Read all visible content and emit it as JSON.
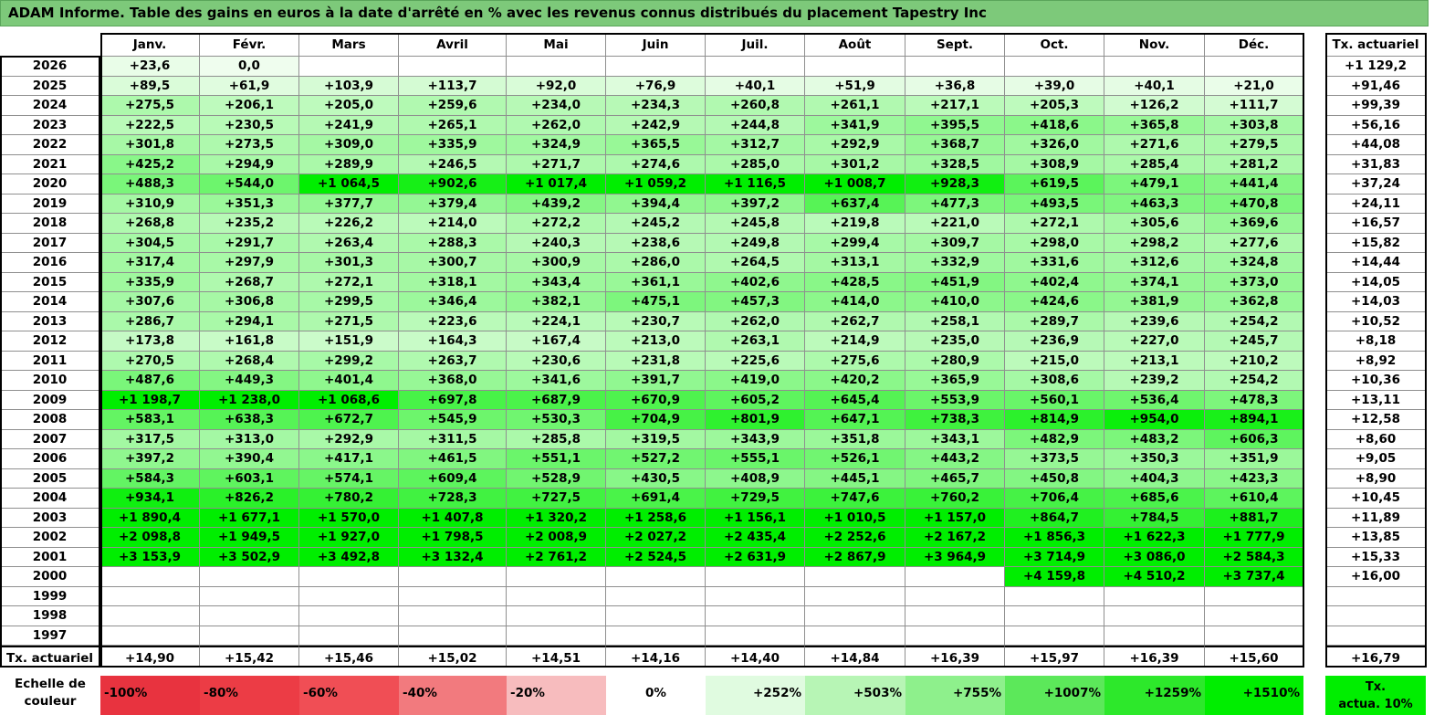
{
  "title": "ADAM Informe. Table des gains en euros à la date d'arrêté en % avec les revenus connus distribués du placement Tapestry Inc",
  "months": [
    "Janv.",
    "Févr.",
    "Mars",
    "Avril",
    "Mai",
    "Juin",
    "Juil.",
    "Août",
    "Sept.",
    "Oct.",
    "Nov.",
    "Déc."
  ],
  "rate_header": "Tx. actuariel",
  "rows": [
    {
      "year": "2026",
      "values": [
        "+23,6",
        "0,0",
        "",
        "",
        "",
        "",
        "",
        "",
        "",
        "",
        "",
        ""
      ],
      "rate": "+1 129,2"
    },
    {
      "year": "2025",
      "values": [
        "+89,5",
        "+61,9",
        "+103,9",
        "+113,7",
        "+92,0",
        "+76,9",
        "+40,1",
        "+51,9",
        "+36,8",
        "+39,0",
        "+40,1",
        "+21,0"
      ],
      "rate": "+91,46"
    },
    {
      "year": "2024",
      "values": [
        "+275,5",
        "+206,1",
        "+205,0",
        "+259,6",
        "+234,0",
        "+234,3",
        "+260,8",
        "+261,1",
        "+217,1",
        "+205,3",
        "+126,2",
        "+111,7"
      ],
      "rate": "+99,39"
    },
    {
      "year": "2023",
      "values": [
        "+222,5",
        "+230,5",
        "+241,9",
        "+265,1",
        "+262,0",
        "+242,9",
        "+244,8",
        "+341,9",
        "+395,5",
        "+418,6",
        "+365,8",
        "+303,8"
      ],
      "rate": "+56,16"
    },
    {
      "year": "2022",
      "values": [
        "+301,8",
        "+273,5",
        "+309,0",
        "+335,9",
        "+324,9",
        "+365,5",
        "+312,7",
        "+292,9",
        "+368,7",
        "+326,0",
        "+271,6",
        "+279,5"
      ],
      "rate": "+44,08"
    },
    {
      "year": "2021",
      "values": [
        "+425,2",
        "+294,9",
        "+289,9",
        "+246,5",
        "+271,7",
        "+274,6",
        "+285,0",
        "+301,2",
        "+328,5",
        "+308,9",
        "+285,4",
        "+281,2"
      ],
      "rate": "+31,83"
    },
    {
      "year": "2020",
      "values": [
        "+488,3",
        "+544,0",
        "+1 064,5",
        "+902,6",
        "+1 017,4",
        "+1 059,2",
        "+1 116,5",
        "+1 008,7",
        "+928,3",
        "+619,5",
        "+479,1",
        "+441,4"
      ],
      "rate": "+37,24"
    },
    {
      "year": "2019",
      "values": [
        "+310,9",
        "+351,3",
        "+377,7",
        "+379,4",
        "+439,2",
        "+394,4",
        "+397,2",
        "+637,4",
        "+477,3",
        "+493,5",
        "+463,3",
        "+470,8"
      ],
      "rate": "+24,11"
    },
    {
      "year": "2018",
      "values": [
        "+268,8",
        "+235,2",
        "+226,2",
        "+214,0",
        "+272,2",
        "+245,2",
        "+245,8",
        "+219,8",
        "+221,0",
        "+272,1",
        "+305,6",
        "+369,6"
      ],
      "rate": "+16,57"
    },
    {
      "year": "2017",
      "values": [
        "+304,5",
        "+291,7",
        "+263,4",
        "+288,3",
        "+240,3",
        "+238,6",
        "+249,8",
        "+299,4",
        "+309,7",
        "+298,0",
        "+298,2",
        "+277,6"
      ],
      "rate": "+15,82"
    },
    {
      "year": "2016",
      "values": [
        "+317,4",
        "+297,9",
        "+301,3",
        "+300,7",
        "+300,9",
        "+286,0",
        "+264,5",
        "+313,1",
        "+332,9",
        "+331,6",
        "+312,6",
        "+324,8"
      ],
      "rate": "+14,44"
    },
    {
      "year": "2015",
      "values": [
        "+335,9",
        "+268,7",
        "+272,1",
        "+318,1",
        "+343,4",
        "+361,1",
        "+402,6",
        "+428,5",
        "+451,9",
        "+402,4",
        "+374,1",
        "+373,0"
      ],
      "rate": "+14,05"
    },
    {
      "year": "2014",
      "values": [
        "+307,6",
        "+306,8",
        "+299,5",
        "+346,4",
        "+382,1",
        "+475,1",
        "+457,3",
        "+414,0",
        "+410,0",
        "+424,6",
        "+381,9",
        "+362,8"
      ],
      "rate": "+14,03"
    },
    {
      "year": "2013",
      "values": [
        "+286,7",
        "+294,1",
        "+271,5",
        "+223,6",
        "+224,1",
        "+230,7",
        "+262,0",
        "+262,7",
        "+258,1",
        "+289,7",
        "+239,6",
        "+254,2"
      ],
      "rate": "+10,52"
    },
    {
      "year": "2012",
      "values": [
        "+173,8",
        "+161,8",
        "+151,9",
        "+164,3",
        "+167,4",
        "+213,0",
        "+263,1",
        "+214,9",
        "+235,0",
        "+236,9",
        "+227,0",
        "+245,7"
      ],
      "rate": "+8,18"
    },
    {
      "year": "2011",
      "values": [
        "+270,5",
        "+268,4",
        "+299,2",
        "+263,7",
        "+230,6",
        "+231,8",
        "+225,6",
        "+275,6",
        "+280,9",
        "+215,0",
        "+213,1",
        "+210,2"
      ],
      "rate": "+8,92"
    },
    {
      "year": "2010",
      "values": [
        "+487,6",
        "+449,3",
        "+401,4",
        "+368,0",
        "+341,6",
        "+391,7",
        "+419,0",
        "+420,2",
        "+365,9",
        "+308,6",
        "+239,2",
        "+254,2"
      ],
      "rate": "+10,36"
    },
    {
      "year": "2009",
      "values": [
        "+1 198,7",
        "+1 238,0",
        "+1 068,6",
        "+697,8",
        "+687,9",
        "+670,9",
        "+605,2",
        "+645,4",
        "+553,9",
        "+560,1",
        "+536,4",
        "+478,3"
      ],
      "rate": "+13,11"
    },
    {
      "year": "2008",
      "values": [
        "+583,1",
        "+638,3",
        "+672,7",
        "+545,9",
        "+530,3",
        "+704,9",
        "+801,9",
        "+647,1",
        "+738,3",
        "+814,9",
        "+954,0",
        "+894,1"
      ],
      "rate": "+12,58"
    },
    {
      "year": "2007",
      "values": [
        "+317,5",
        "+313,0",
        "+292,9",
        "+311,5",
        "+285,8",
        "+319,5",
        "+343,9",
        "+351,8",
        "+343,1",
        "+482,9",
        "+483,2",
        "+606,3"
      ],
      "rate": "+8,60"
    },
    {
      "year": "2006",
      "values": [
        "+397,2",
        "+390,4",
        "+417,1",
        "+461,5",
        "+551,1",
        "+527,2",
        "+555,1",
        "+526,1",
        "+443,2",
        "+373,5",
        "+350,3",
        "+351,9"
      ],
      "rate": "+9,05"
    },
    {
      "year": "2005",
      "values": [
        "+584,3",
        "+603,1",
        "+574,1",
        "+609,4",
        "+528,9",
        "+430,5",
        "+408,9",
        "+445,1",
        "+465,7",
        "+450,8",
        "+404,3",
        "+423,3"
      ],
      "rate": "+8,90"
    },
    {
      "year": "2004",
      "values": [
        "+934,1",
        "+826,2",
        "+780,2",
        "+728,3",
        "+727,5",
        "+691,4",
        "+729,5",
        "+747,6",
        "+760,2",
        "+706,4",
        "+685,6",
        "+610,4"
      ],
      "rate": "+10,45"
    },
    {
      "year": "2003",
      "values": [
        "+1 890,4",
        "+1 677,1",
        "+1 570,0",
        "+1 407,8",
        "+1 320,2",
        "+1 258,6",
        "+1 156,1",
        "+1 010,5",
        "+1 157,0",
        "+864,7",
        "+784,5",
        "+881,7"
      ],
      "rate": "+11,89"
    },
    {
      "year": "2002",
      "values": [
        "+2 098,8",
        "+1 949,5",
        "+1 927,0",
        "+1 798,5",
        "+2 008,9",
        "+2 027,2",
        "+2 435,4",
        "+2 252,6",
        "+2 167,2",
        "+1 856,3",
        "+1 622,3",
        "+1 777,9"
      ],
      "rate": "+13,85"
    },
    {
      "year": "2001",
      "values": [
        "+3 153,9",
        "+3 502,9",
        "+3 492,8",
        "+3 132,4",
        "+2 761,2",
        "+2 524,5",
        "+2 631,9",
        "+2 867,9",
        "+3 964,9",
        "+3 714,9",
        "+3 086,0",
        "+2 584,3"
      ],
      "rate": "+15,33"
    },
    {
      "year": "2000",
      "values": [
        "",
        "",
        "",
        "",
        "",
        "",
        "",
        "",
        "",
        "+4 159,8",
        "+4 510,2",
        "+3 737,4"
      ],
      "rate": "+16,00"
    },
    {
      "year": "1999",
      "values": [
        "",
        "",
        "",
        "",
        "",
        "",
        "",
        "",
        "",
        "",
        "",
        ""
      ],
      "rate": ""
    },
    {
      "year": "1998",
      "values": [
        "",
        "",
        "",
        "",
        "",
        "",
        "",
        "",
        "",
        "",
        "",
        ""
      ],
      "rate": ""
    },
    {
      "year": "1997",
      "values": [
        "",
        "",
        "",
        "",
        "",
        "",
        "",
        "",
        "",
        "",
        "",
        ""
      ],
      "rate": ""
    }
  ],
  "footer": {
    "label": "Tx. actuariel",
    "values": [
      "+14,90",
      "+15,42",
      "+15,46",
      "+15,02",
      "+14,51",
      "+14,16",
      "+14,40",
      "+14,84",
      "+16,39",
      "+15,97",
      "+16,39",
      "+15,60"
    ],
    "rate": "+16,79"
  },
  "legend": {
    "label_line1": "Echelle de",
    "label_line2": "couleur",
    "items": [
      {
        "text": "-100%",
        "color": "#e8333f",
        "align": "left"
      },
      {
        "text": "-80%",
        "color": "#ec3c45",
        "align": "left"
      },
      {
        "text": "-60%",
        "color": "#f04e55",
        "align": "left"
      },
      {
        "text": "-40%",
        "color": "#f27a7e",
        "align": "left"
      },
      {
        "text": "-20%",
        "color": "#f7bcbe",
        "align": "left"
      },
      {
        "text": "0%",
        "color": "#ffffff",
        "align": "center"
      },
      {
        "text": "+252%",
        "color": "#e0fbe0",
        "align": "right"
      },
      {
        "text": "+503%",
        "color": "#b7f5b5",
        "align": "right"
      },
      {
        "text": "+755%",
        "color": "#8ef08c",
        "align": "right"
      },
      {
        "text": "+1007%",
        "color": "#5ce85a",
        "align": "right"
      },
      {
        "text": "+1259%",
        "color": "#2de82b",
        "align": "right"
      },
      {
        "text": "+1510%",
        "color": "#00ee00",
        "align": "right"
      }
    ],
    "tx_line1": "Tx.",
    "tx_line2": "actua. 10%",
    "tx_color": "#00ee00"
  }
}
